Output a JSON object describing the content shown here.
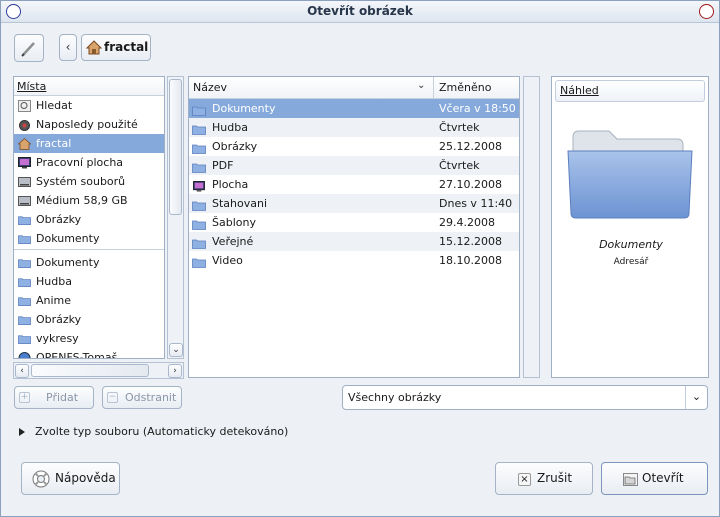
{
  "window": {
    "title": "Otevřít obrázek"
  },
  "location": {
    "back_label": "‹",
    "crumb_label": "fractal"
  },
  "places": {
    "header": "Místa",
    "items": [
      {
        "label": "Hledat",
        "icon": "search-icon"
      },
      {
        "label": "Naposledy použité",
        "icon": "recent-icon"
      },
      {
        "label": "fractal",
        "icon": "home-icon",
        "selected": true
      },
      {
        "label": "Pracovní plocha",
        "icon": "desktop-icon"
      },
      {
        "label": "Systém souborů",
        "icon": "drive-icon"
      },
      {
        "label": "Médium 58,9 GB",
        "icon": "drive-icon"
      },
      {
        "label": "Obrázky",
        "icon": "folder-icon"
      },
      {
        "label": "Dokumenty",
        "icon": "folder-icon"
      }
    ],
    "bookmarks": [
      {
        "label": "Dokumenty",
        "icon": "folder-icon"
      },
      {
        "label": "Hudba",
        "icon": "folder-icon"
      },
      {
        "label": "Anime",
        "icon": "folder-icon"
      },
      {
        "label": "Obrázky",
        "icon": "folder-icon"
      },
      {
        "label": "vykresy",
        "icon": "folder-icon"
      },
      {
        "label": "OPENFS-Tomaš...",
        "icon": "globe-icon"
      }
    ]
  },
  "files": {
    "col_name": "Název",
    "col_modified": "Změněno",
    "rows": [
      {
        "name": "Dokumenty",
        "date": "Včera v 18:50",
        "icon": "folder-icon"
      },
      {
        "name": "Hudba",
        "date": "Čtvrtek",
        "icon": "folder-icon"
      },
      {
        "name": "Obrázky",
        "date": "25.12.2008",
        "icon": "folder-icon"
      },
      {
        "name": "PDF",
        "date": "Čtvrtek",
        "icon": "folder-icon"
      },
      {
        "name": "Plocha",
        "date": "27.10.2008",
        "icon": "desktop-icon"
      },
      {
        "name": "Stahovani",
        "date": "Dnes v 11:40",
        "icon": "folder-icon"
      },
      {
        "name": "Šablony",
        "date": "29.4.2008",
        "icon": "folder-icon"
      },
      {
        "name": "Veřejné",
        "date": "15.12.2008",
        "icon": "folder-icon"
      },
      {
        "name": "Video",
        "date": "18.10.2008",
        "icon": "folder-icon"
      }
    ]
  },
  "preview": {
    "header": "Náhled",
    "name": "Dokumenty",
    "type": "Adresář"
  },
  "buttons": {
    "add": "Přidat",
    "remove": "Odstranit",
    "help": "Nápověda",
    "cancel": "Zrušit",
    "open": "Otevřít"
  },
  "filter": {
    "selected": "Všechny obrázky"
  },
  "expander": {
    "label": "Zvolte typ souboru (Automaticky detekováno)"
  },
  "colors": {
    "selection": "#86a9dc",
    "window_bg": "#edf1f6",
    "folder": "#8fb0e2"
  }
}
